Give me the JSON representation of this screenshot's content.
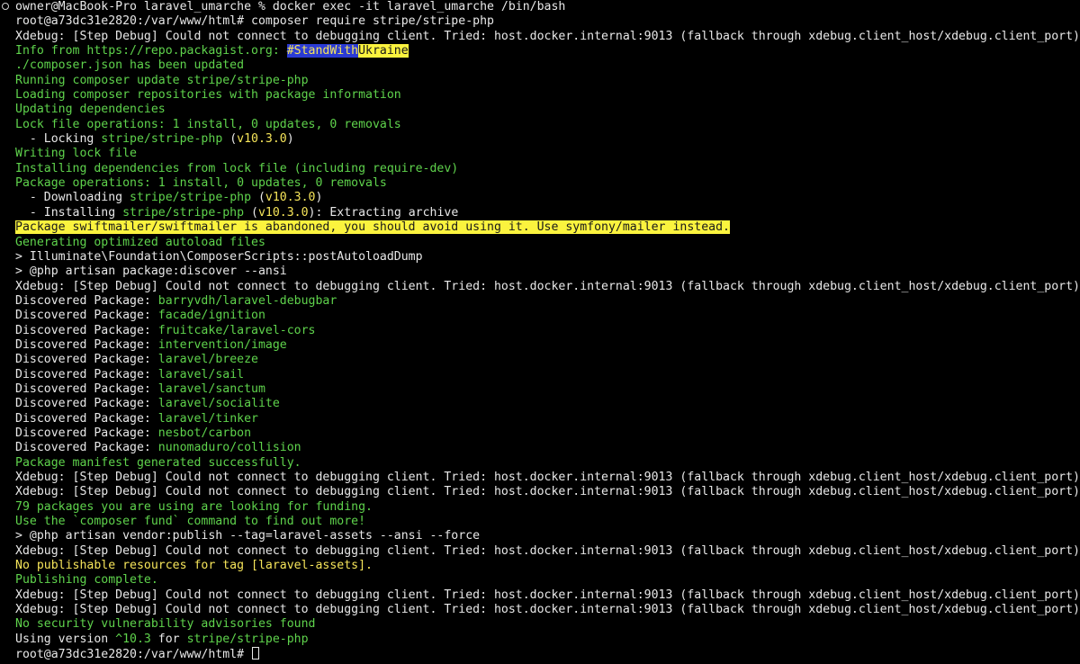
{
  "colors": {
    "background": "#000000",
    "text": "#e8e8e8",
    "green": "#5fd34c",
    "yellow": "#f6e55a",
    "highlight_blue": "#2b3bd4",
    "highlight_yellow": "#fbf33e"
  },
  "lines": [
    [
      {
        "t": "owner@MacBook-Pro laravel_umarche % docker exec -it laravel_umarche /bin/bash",
        "c": "w"
      }
    ],
    [
      {
        "t": "root@a73dc31e2820:/var/www/html# composer require stripe/stripe-php",
        "c": "w"
      }
    ],
    [
      {
        "t": "Xdebug: [Step Debug] Could not connect to debugging client. Tried: host.docker.internal:9013 (fallback through xdebug.client_host/xdebug.client_port).",
        "c": "w"
      }
    ],
    [
      {
        "t": "Info from https://repo.packagist.org: ",
        "c": "g"
      },
      {
        "t": "#StandWith",
        "c": "hl-blue"
      },
      {
        "t": "Ukraine",
        "c": "hl-yellow"
      }
    ],
    [
      {
        "t": "./composer.json has been updated",
        "c": "g"
      }
    ],
    [
      {
        "t": "Running composer update stripe/stripe-php",
        "c": "g"
      }
    ],
    [
      {
        "t": "Loading composer repositories with package information",
        "c": "g"
      }
    ],
    [
      {
        "t": "Updating dependencies",
        "c": "g"
      }
    ],
    [
      {
        "t": "Lock file operations: 1 install, 0 updates, 0 removals",
        "c": "g"
      }
    ],
    [
      {
        "t": "  - Locking ",
        "c": "w"
      },
      {
        "t": "stripe/stripe-php",
        "c": "g"
      },
      {
        "t": " (",
        "c": "w"
      },
      {
        "t": "v10.3.0",
        "c": "y"
      },
      {
        "t": ")",
        "c": "w"
      }
    ],
    [
      {
        "t": "Writing lock file",
        "c": "g"
      }
    ],
    [
      {
        "t": "Installing dependencies from lock file (including require-dev)",
        "c": "g"
      }
    ],
    [
      {
        "t": "Package operations: 1 install, 0 updates, 0 removals",
        "c": "g"
      }
    ],
    [
      {
        "t": "  - Downloading ",
        "c": "w"
      },
      {
        "t": "stripe/stripe-php",
        "c": "g"
      },
      {
        "t": " (",
        "c": "w"
      },
      {
        "t": "v10.3.0",
        "c": "y"
      },
      {
        "t": ")",
        "c": "w"
      }
    ],
    [
      {
        "t": "  - Installing ",
        "c": "w"
      },
      {
        "t": "stripe/stripe-php",
        "c": "g"
      },
      {
        "t": " (",
        "c": "w"
      },
      {
        "t": "v10.3.0",
        "c": "y"
      },
      {
        "t": "): Extracting archive",
        "c": "w"
      }
    ],
    [
      {
        "t": "Package swiftmailer/swiftmailer is abandoned, you should avoid using it. Use symfony/mailer instead.",
        "c": "hl-warn"
      }
    ],
    [
      {
        "t": "Generating optimized autoload files",
        "c": "g"
      }
    ],
    [
      {
        "t": "> Illuminate\\Foundation\\ComposerScripts::postAutoloadDump",
        "c": "w"
      }
    ],
    [
      {
        "t": "> @php artisan package:discover --ansi",
        "c": "w"
      }
    ],
    [
      {
        "t": "Xdebug: [Step Debug] Could not connect to debugging client. Tried: host.docker.internal:9013 (fallback through xdebug.client_host/xdebug.client_port).",
        "c": "w"
      }
    ],
    [
      {
        "t": "Discovered Package: ",
        "c": "w"
      },
      {
        "t": "barryvdh/laravel-debugbar",
        "c": "g"
      }
    ],
    [
      {
        "t": "Discovered Package: ",
        "c": "w"
      },
      {
        "t": "facade/ignition",
        "c": "g"
      }
    ],
    [
      {
        "t": "Discovered Package: ",
        "c": "w"
      },
      {
        "t": "fruitcake/laravel-cors",
        "c": "g"
      }
    ],
    [
      {
        "t": "Discovered Package: ",
        "c": "w"
      },
      {
        "t": "intervention/image",
        "c": "g"
      }
    ],
    [
      {
        "t": "Discovered Package: ",
        "c": "w"
      },
      {
        "t": "laravel/breeze",
        "c": "g"
      }
    ],
    [
      {
        "t": "Discovered Package: ",
        "c": "w"
      },
      {
        "t": "laravel/sail",
        "c": "g"
      }
    ],
    [
      {
        "t": "Discovered Package: ",
        "c": "w"
      },
      {
        "t": "laravel/sanctum",
        "c": "g"
      }
    ],
    [
      {
        "t": "Discovered Package: ",
        "c": "w"
      },
      {
        "t": "laravel/socialite",
        "c": "g"
      }
    ],
    [
      {
        "t": "Discovered Package: ",
        "c": "w"
      },
      {
        "t": "laravel/tinker",
        "c": "g"
      }
    ],
    [
      {
        "t": "Discovered Package: ",
        "c": "w"
      },
      {
        "t": "nesbot/carbon",
        "c": "g"
      }
    ],
    [
      {
        "t": "Discovered Package: ",
        "c": "w"
      },
      {
        "t": "nunomaduro/collision",
        "c": "g"
      }
    ],
    [
      {
        "t": "Package manifest generated successfully.",
        "c": "g"
      }
    ],
    [
      {
        "t": "Xdebug: [Step Debug] Could not connect to debugging client. Tried: host.docker.internal:9013 (fallback through xdebug.client_host/xdebug.client_port).",
        "c": "w"
      }
    ],
    [
      {
        "t": "Xdebug: [Step Debug] Could not connect to debugging client. Tried: host.docker.internal:9013 (fallback through xdebug.client_host/xdebug.client_port).",
        "c": "w"
      }
    ],
    [
      {
        "t": "79 packages you are using are looking for funding.",
        "c": "g"
      }
    ],
    [
      {
        "t": "Use the `composer fund` command to find out more!",
        "c": "g"
      }
    ],
    [
      {
        "t": "> @php artisan vendor:publish --tag=laravel-assets --ansi --force",
        "c": "w"
      }
    ],
    [
      {
        "t": "Xdebug: [Step Debug] Could not connect to debugging client. Tried: host.docker.internal:9013 (fallback through xdebug.client_host/xdebug.client_port).",
        "c": "w"
      }
    ],
    [
      {
        "t": "No publishable resources for tag [laravel-assets].",
        "c": "y"
      }
    ],
    [
      {
        "t": "Publishing complete.",
        "c": "g"
      }
    ],
    [
      {
        "t": "Xdebug: [Step Debug] Could not connect to debugging client. Tried: host.docker.internal:9013 (fallback through xdebug.client_host/xdebug.client_port).",
        "c": "w"
      }
    ],
    [
      {
        "t": "Xdebug: [Step Debug] Could not connect to debugging client. Tried: host.docker.internal:9013 (fallback through xdebug.client_host/xdebug.client_port).",
        "c": "w"
      }
    ],
    [
      {
        "t": "No security vulnerability advisories found",
        "c": "g"
      }
    ],
    [
      {
        "t": "Using version ",
        "c": "w"
      },
      {
        "t": "^10.3",
        "c": "g"
      },
      {
        "t": " for ",
        "c": "w"
      },
      {
        "t": "stripe/stripe-php",
        "c": "g"
      }
    ],
    [
      {
        "t": "root@a73dc31e2820:/var/www/html# ",
        "c": "w"
      }
    ]
  ]
}
